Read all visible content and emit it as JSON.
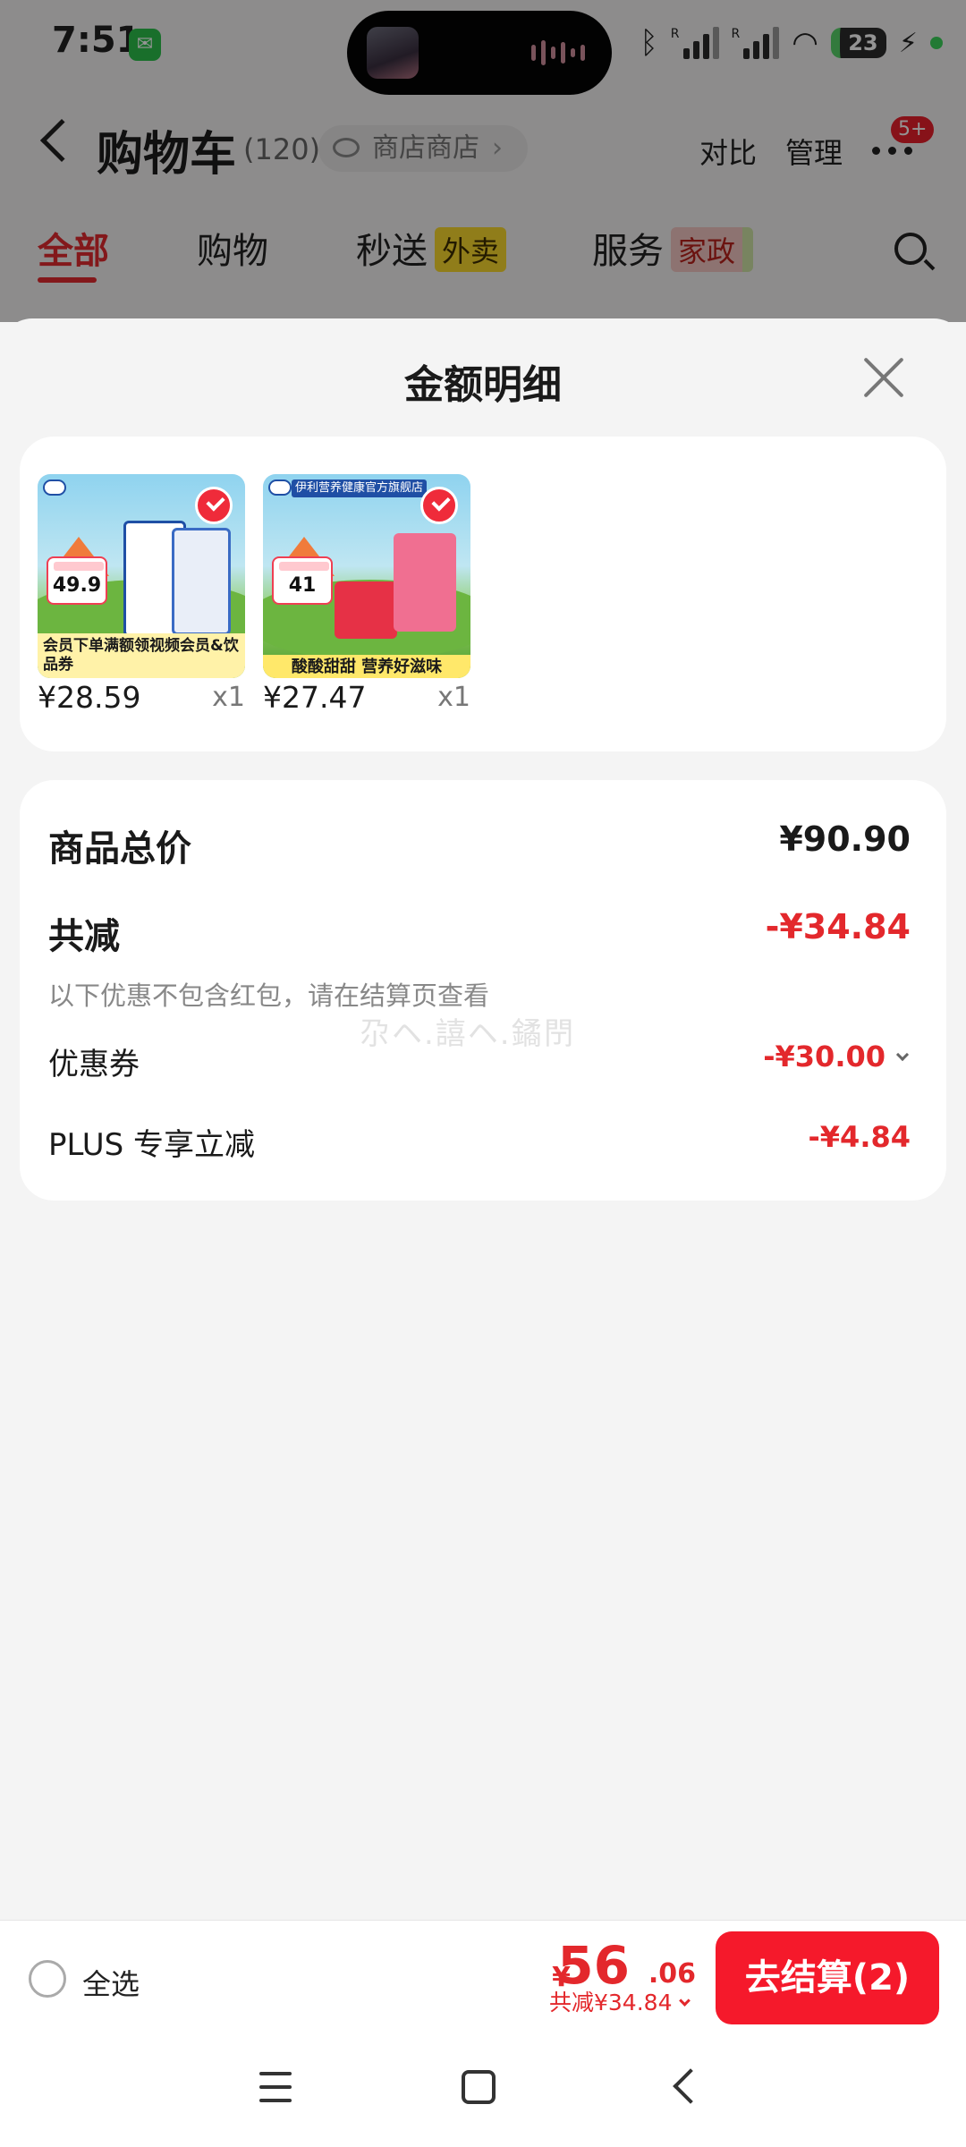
{
  "status_bar": {
    "time": "7:51",
    "battery": "23",
    "carrier_r1": "R",
    "carrier_r2": "R"
  },
  "header": {
    "title": "购物车",
    "count": "(120)",
    "store_pill": "商店商店",
    "compare": "对比",
    "manage": "管理",
    "badge": "5+"
  },
  "tabs": [
    {
      "label": "全部"
    },
    {
      "label": "购物"
    },
    {
      "label": "秒送",
      "tag": "外卖"
    },
    {
      "label": "服务",
      "tag": "家政"
    }
  ],
  "sheet": {
    "title": "金额明细",
    "products": [
      {
        "price": "¥28.59",
        "qty": "x1",
        "badge_price": "49.9",
        "banner": "会员下单满额领视频会员&饮品券"
      },
      {
        "price": "¥27.47",
        "qty": "x1",
        "badge_price": "41",
        "banner": "酸酸甜甜 营养好滋味",
        "store": "伊利营养健康官方旗舰店"
      }
    ],
    "summary": {
      "total_label": "商品总价",
      "total_value": "¥90.90",
      "discount_label": "共减",
      "discount_value": "-¥34.84",
      "note": "以下优惠不包含红包，请在结算页查看",
      "watermark": "尕ヘ.譆ヘ.鐍閅",
      "coupon_label": "优惠券",
      "coupon_value": "-¥30.00",
      "plus_label": "PLUS 专享立减",
      "plus_value": "-¥4.84"
    }
  },
  "bottom_bar": {
    "select_all": "全选",
    "currency": "¥",
    "total_int": "56",
    "total_dec": ".06",
    "saved": "共减¥34.84",
    "checkout": "去结算(2)"
  },
  "colors": {
    "accent_red": "#e3282c",
    "button_red": "#f5192b",
    "background": "#f4f4f4"
  }
}
